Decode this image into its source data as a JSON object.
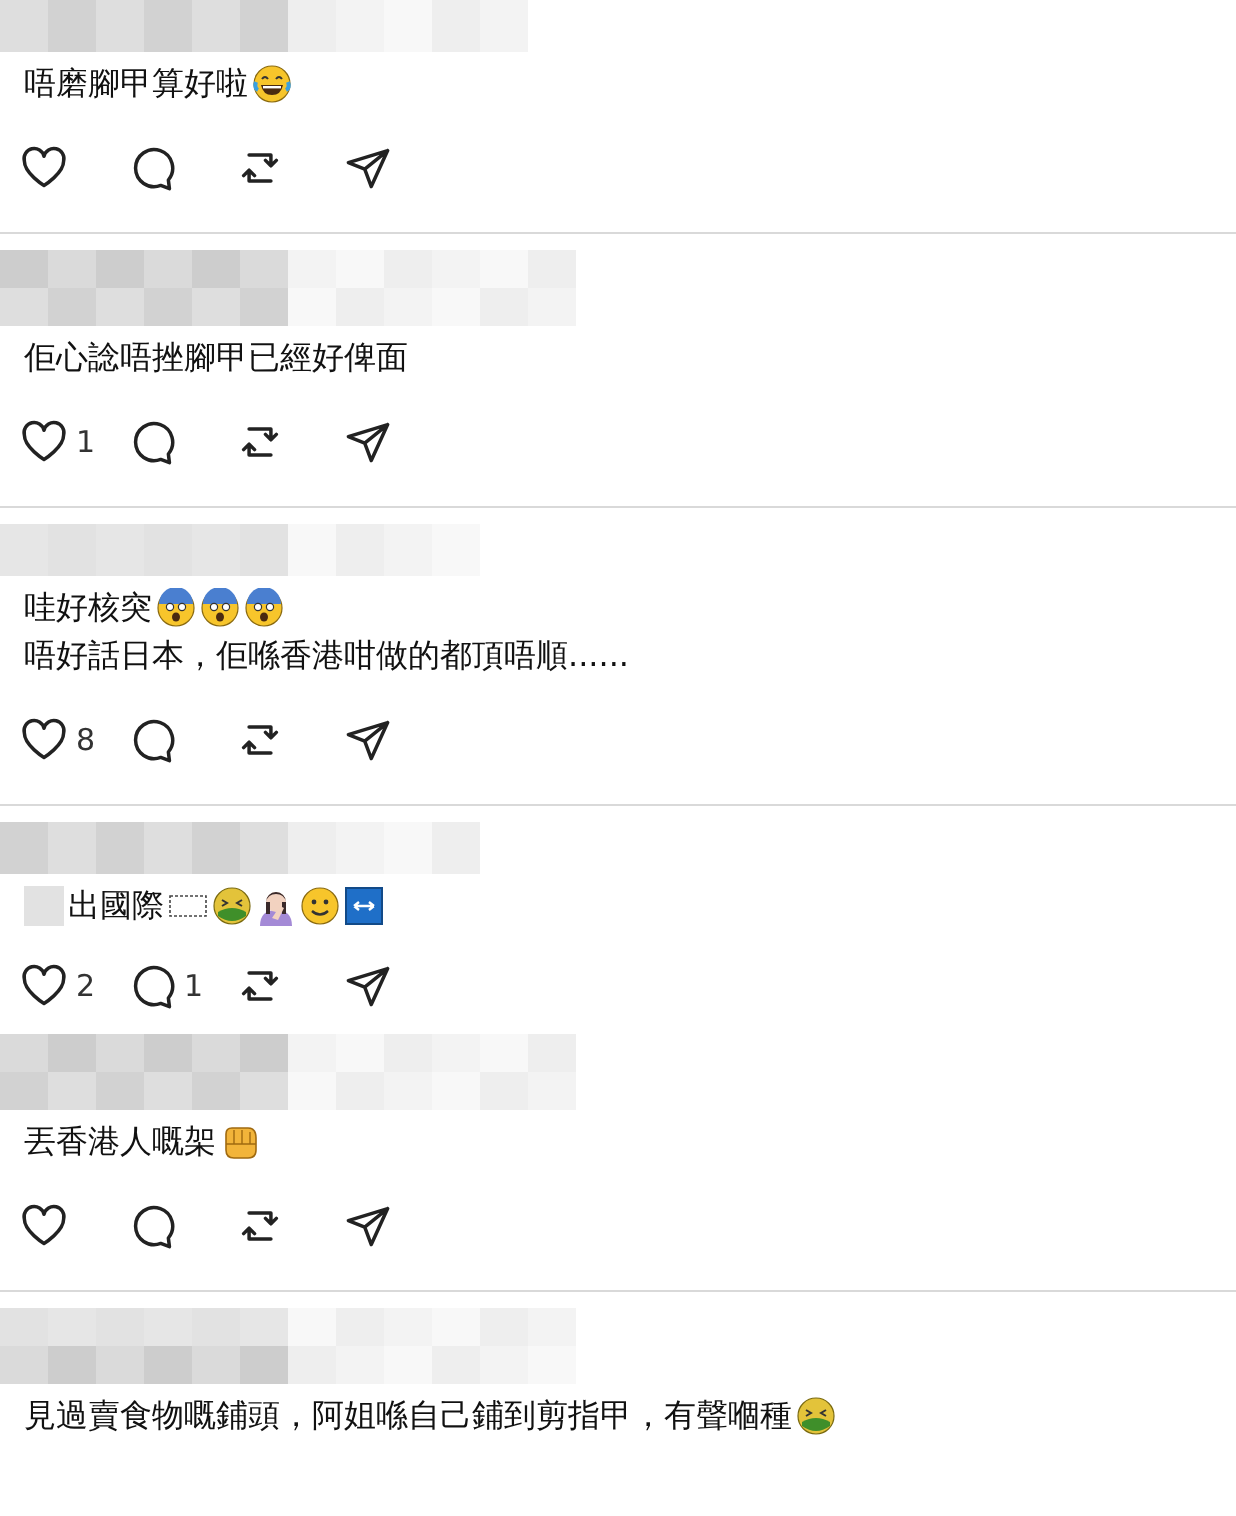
{
  "threads": [
    {
      "posts": [
        {
          "lines": [
            [
              {
                "kind": "text",
                "text": "唔磨腳甲算好啦"
              },
              {
                "kind": "laughing"
              }
            ]
          ]
        }
      ]
    },
    {
      "posts": [
        {
          "lines": [
            [
              {
                "kind": "text",
                "text": "佢心諗唔挫腳甲已經好俾面"
              }
            ]
          ],
          "likes": "1"
        }
      ]
    },
    {
      "posts": [
        {
          "lines": [
            [
              {
                "kind": "text",
                "text": "哇好核突"
              },
              {
                "kind": "fearful"
              },
              {
                "kind": "fearful"
              },
              {
                "kind": "fearful"
              }
            ],
            [
              {
                "kind": "text",
                "text": "唔好話日本，佢喺香港咁做的都頂唔順......"
              }
            ]
          ],
          "likes": "8"
        }
      ]
    },
    {
      "posts": [
        {
          "lines": [
            [
              {
                "kind": "redacted"
              },
              {
                "kind": "text",
                "text": "出國際"
              },
              {
                "kind": "obj"
              },
              {
                "kind": "nauseated"
              },
              {
                "kind": "facepalm"
              },
              {
                "kind": "smile"
              },
              {
                "kind": "arrow-box"
              }
            ]
          ],
          "likes": "2",
          "replies": "1"
        },
        {
          "lines": [
            [
              {
                "kind": "text",
                "text": "丟香港人嘅架"
              },
              {
                "kind": "fist"
              }
            ]
          ]
        }
      ]
    },
    {
      "posts": [
        {
          "lines": [
            [
              {
                "kind": "text",
                "text": "見過賣食物嘅鋪頭，阿姐喺自己鋪到剪指甲，有聲嗰種"
              },
              {
                "kind": "nauseated"
              }
            ]
          ]
        }
      ]
    }
  ]
}
